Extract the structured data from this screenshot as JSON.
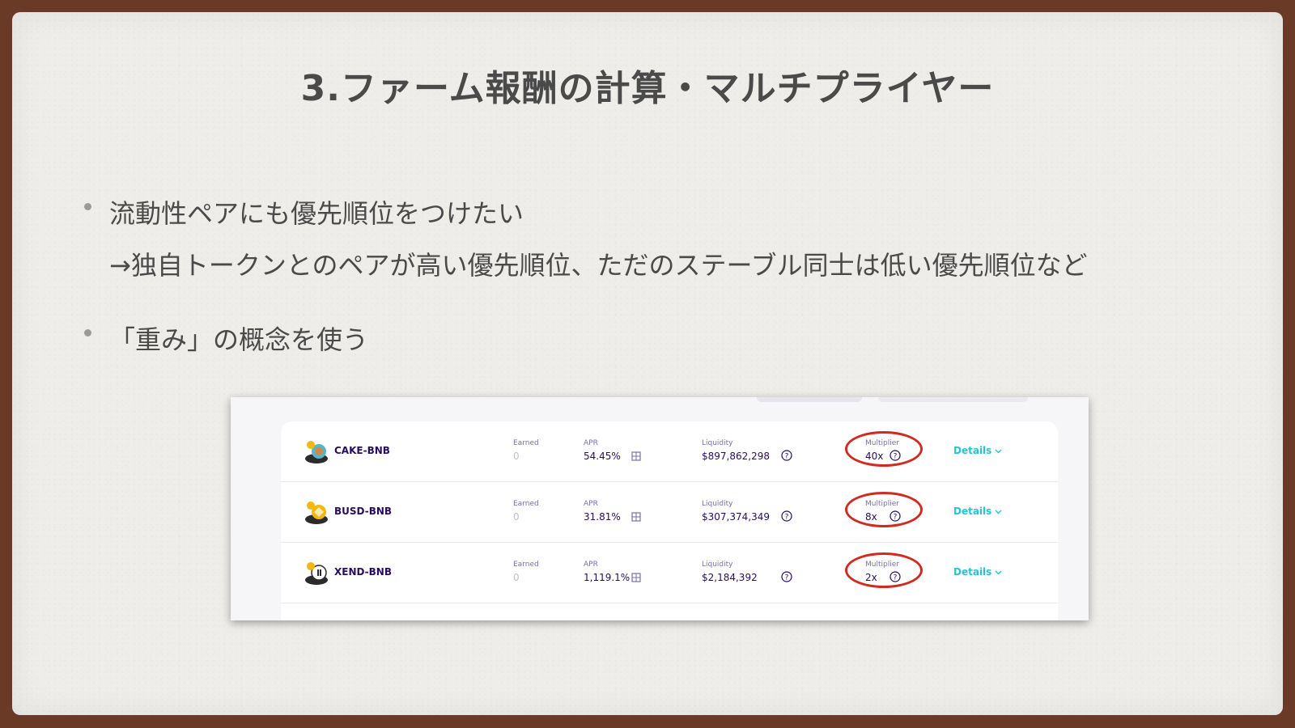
{
  "slide": {
    "title": "3.ファーム報酬の計算・マルチプライヤー",
    "bullets": [
      {
        "text": "流動性ペアにも優先順位をつけたい"
      },
      {
        "text": "→独自トークンとのペアが高い優先順位、ただのステーブル同士は低い優先順位など"
      },
      {
        "text": "「重み」の概念を使う"
      }
    ]
  },
  "farm_table": {
    "labels": {
      "earned": "Earned",
      "apr": "APR",
      "liquidity": "Liquidity",
      "multiplier": "Multiplier",
      "details": "Details"
    },
    "rows": [
      {
        "pair": "CAKE-BNB",
        "earned": "0",
        "apr": "54.45%",
        "liquidity": "$897,862,298",
        "multiplier": "40x"
      },
      {
        "pair": "BUSD-BNB",
        "earned": "0",
        "apr": "31.81%",
        "liquidity": "$307,374,349",
        "multiplier": "8x"
      },
      {
        "pair": "XEND-BNB",
        "earned": "0",
        "apr": "1,119.1%",
        "liquidity": "$2,184,392",
        "multiplier": "2x"
      }
    ],
    "colors": {
      "pair_text": "#280d5f",
      "label_text": "#7a6eaa",
      "details_link": "#1fc7d4",
      "highlight_ring": "#cf2b20"
    },
    "icons": [
      "token-pair-icon",
      "calculator-icon",
      "help-circle-icon",
      "chevron-down-icon"
    ]
  }
}
